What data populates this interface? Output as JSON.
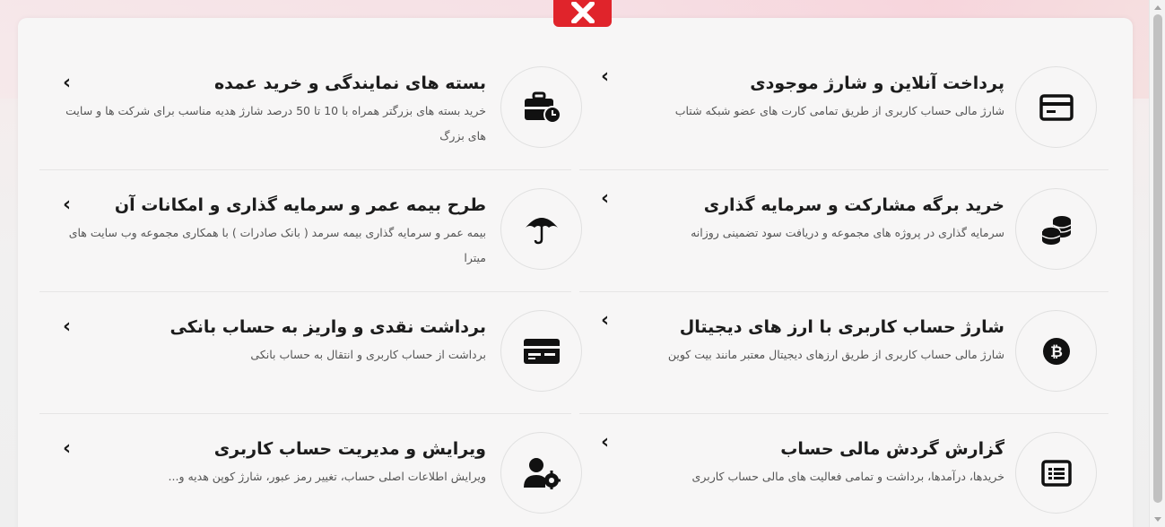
{
  "close_button_label": "close",
  "left_column": [
    {
      "title": "بسته های نمایندگی و خرید عمده",
      "desc": "خرید بسته های بزرگتر همراه با 10 تا 50 درصد شارژ هدیه مناسب برای شرکت ها و سایت های بزرگ",
      "icon": "briefcase-clock-icon"
    },
    {
      "title": "طرح بیمه عمر و سرمایه گذاری و امکانات آن",
      "desc": "بیمه عمر و سرمایه گذاری بیمه سرمد ( بانک صادرات ) با همکاری مجموعه وب سایت های میترا",
      "icon": "umbrella-icon"
    },
    {
      "title": "برداشت نقدی و واریز به حساب بانکی",
      "desc": "برداشت از حساب کاربری و انتقال به حساب بانکی",
      "icon": "bank-card-icon"
    },
    {
      "title": "ویرایش و مدیریت حساب کاربری",
      "desc": "ویرایش اطلاعات اصلی حساب، تغییر رمز عبور، شارژ کوپن هدیه و...",
      "icon": "user-gear-icon"
    }
  ],
  "right_column": [
    {
      "title": "پرداخت آنلاین و شارژ موجودی",
      "desc": "شارژ مالی حساب کاربری از طریق تمامی کارت های عضو شبکه شتاب",
      "icon": "credit-card-icon"
    },
    {
      "title": "خرید برگه مشارکت و سرمایه گذاری",
      "desc": "سرمایه گذاری در پروژه های مجموعه و دریافت سود تضمینی روزانه",
      "icon": "coins-icon"
    },
    {
      "title": "شارژ حساب کاربری با ارز های دیجیتال",
      "desc": "شارژ مالی حساب کاربری از طریق ارزهای دیجیتال معتبر مانند بیت کوین",
      "icon": "bitcoin-icon"
    },
    {
      "title": "گزارش گردش مالی حساب",
      "desc": "خریدها، درآمدها، برداشت و تمامی فعالیت های مالی حساب کاربری",
      "icon": "list-report-icon"
    }
  ],
  "chevron": "‹"
}
